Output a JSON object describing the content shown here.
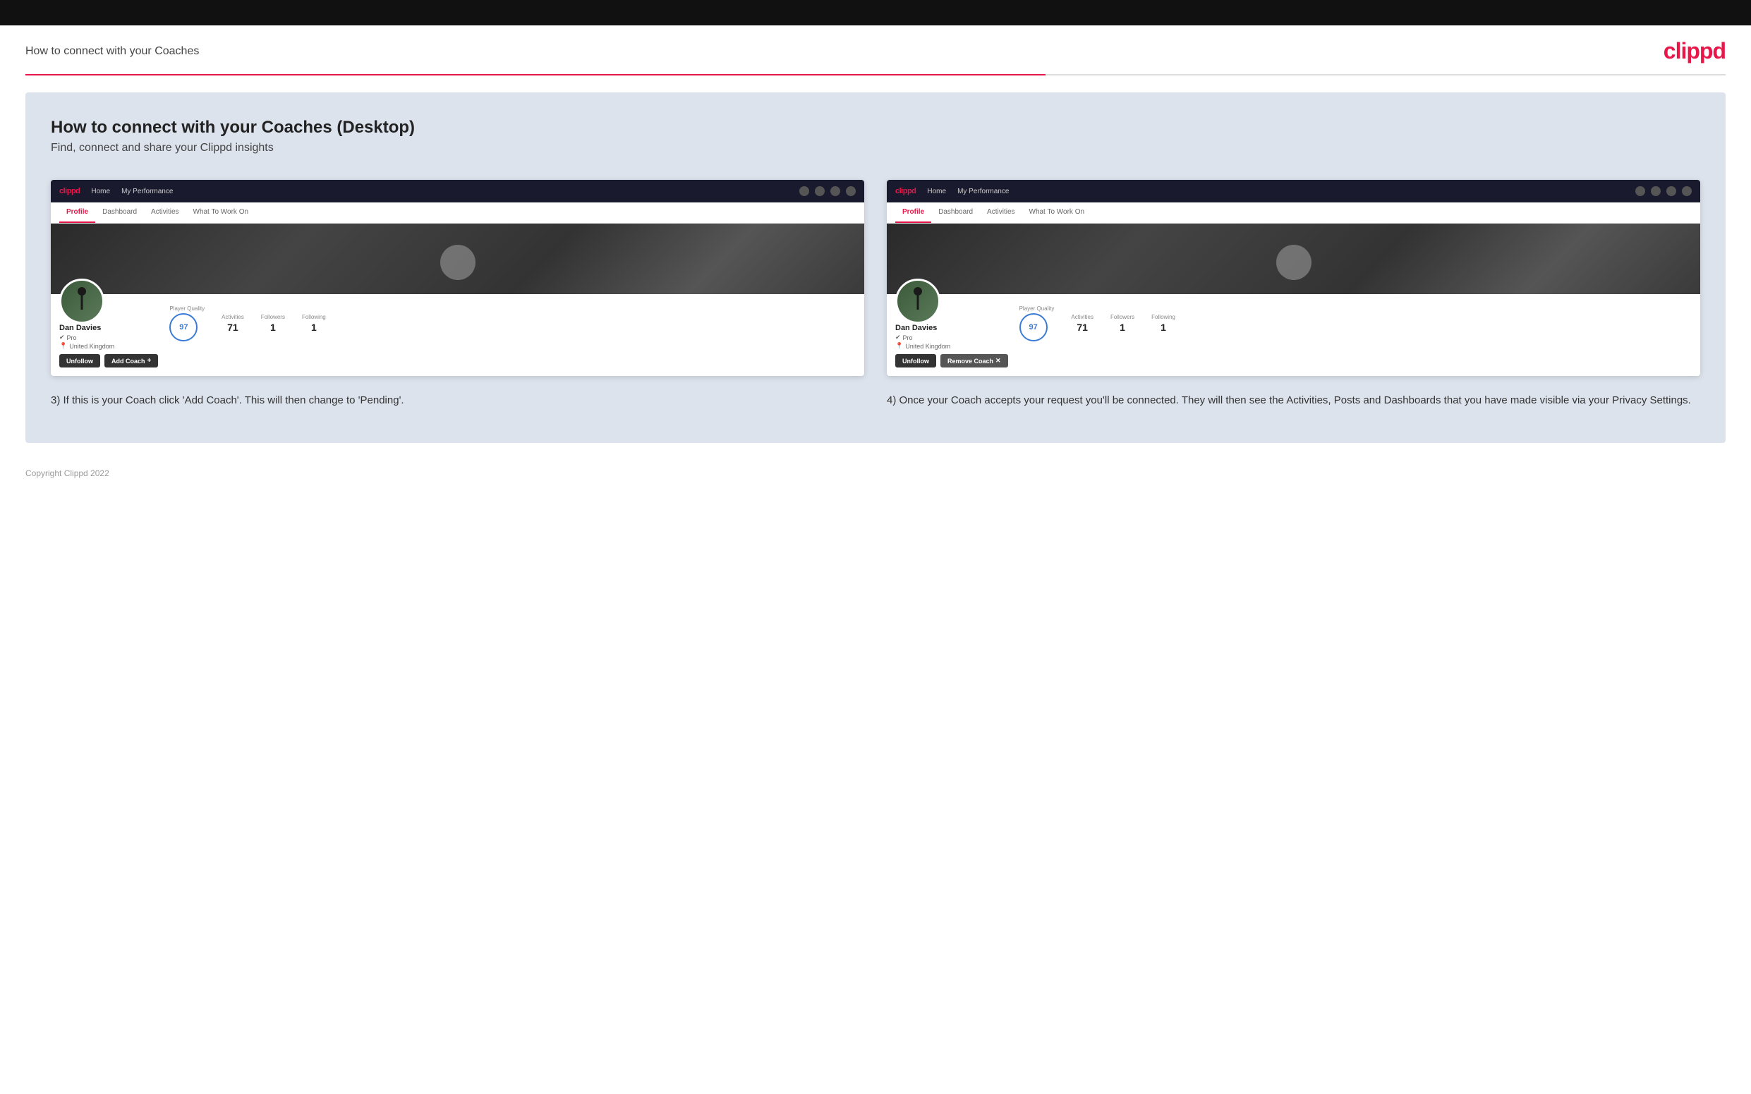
{
  "topbar": {},
  "header": {
    "title": "How to connect with your Coaches",
    "logo": "clippd"
  },
  "main": {
    "heading": "How to connect with your Coaches (Desktop)",
    "subheading": "Find, connect and share your Clippd insights",
    "screenshot_left": {
      "nav": {
        "logo": "clippd",
        "links": [
          "Home",
          "My Performance"
        ]
      },
      "tabs": [
        "Profile",
        "Dashboard",
        "Activities",
        "What To Work On"
      ],
      "active_tab": "Profile",
      "profile": {
        "name": "Dan Davies",
        "role": "Pro",
        "location": "United Kingdom",
        "player_quality_label": "Player Quality",
        "player_quality_value": "97",
        "activities_label": "Activities",
        "activities_value": "71",
        "followers_label": "Followers",
        "followers_value": "1",
        "following_label": "Following",
        "following_value": "1"
      },
      "buttons": {
        "unfollow": "Unfollow",
        "add_coach": "Add Coach"
      }
    },
    "screenshot_right": {
      "nav": {
        "logo": "clippd",
        "links": [
          "Home",
          "My Performance"
        ]
      },
      "tabs": [
        "Profile",
        "Dashboard",
        "Activities",
        "What To Work On"
      ],
      "active_tab": "Profile",
      "profile": {
        "name": "Dan Davies",
        "role": "Pro",
        "location": "United Kingdom",
        "player_quality_label": "Player Quality",
        "player_quality_value": "97",
        "activities_label": "Activities",
        "activities_value": "71",
        "followers_label": "Followers",
        "followers_value": "1",
        "following_label": "Following",
        "following_value": "1"
      },
      "buttons": {
        "unfollow": "Unfollow",
        "remove_coach": "Remove Coach"
      }
    },
    "caption_left": "3) If this is your Coach click 'Add Coach'. This will then change to 'Pending'.",
    "caption_right": "4) Once your Coach accepts your request you'll be connected. They will then see the Activities, Posts and Dashboards that you have made visible via your Privacy Settings."
  },
  "footer": {
    "copyright": "Copyright Clippd 2022"
  }
}
